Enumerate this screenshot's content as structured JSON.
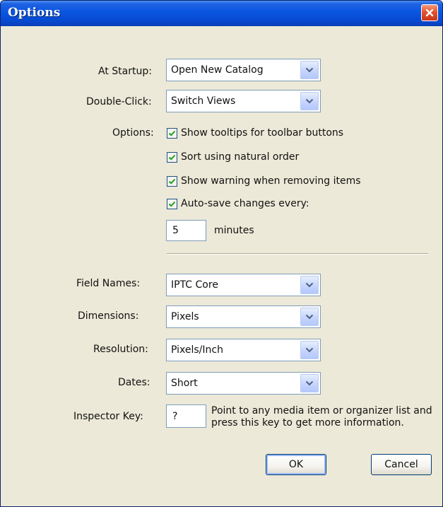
{
  "window": {
    "title": "Options",
    "close_icon": "close-icon",
    "accent": "#0a55e0",
    "close_color": "#e2532c"
  },
  "startup": {
    "label": "At Startup:",
    "value": "Open New Catalog"
  },
  "double_click": {
    "label": "Double-Click:",
    "value": "Switch Views"
  },
  "options": {
    "label": "Options:",
    "items": [
      {
        "label": "Show tooltips for toolbar buttons",
        "checked": true
      },
      {
        "label": "Sort using natural order",
        "checked": true
      },
      {
        "label": "Show warning when removing items",
        "checked": true
      },
      {
        "label": "Auto-save changes every:",
        "checked": true
      }
    ],
    "autosave_value": "5",
    "autosave_unit": "minutes"
  },
  "field_names": {
    "label": "Field Names:",
    "value": "IPTC Core"
  },
  "dimensions": {
    "label": "Dimensions:",
    "value": "Pixels"
  },
  "resolution": {
    "label": "Resolution:",
    "value": "Pixels/Inch"
  },
  "dates": {
    "label": "Dates:",
    "value": "Short"
  },
  "inspector": {
    "label": "Inspector Key:",
    "value": "?",
    "help": "Point to any media item or organizer list and press this key to get more information."
  },
  "buttons": {
    "ok": "OK",
    "cancel": "Cancel"
  }
}
